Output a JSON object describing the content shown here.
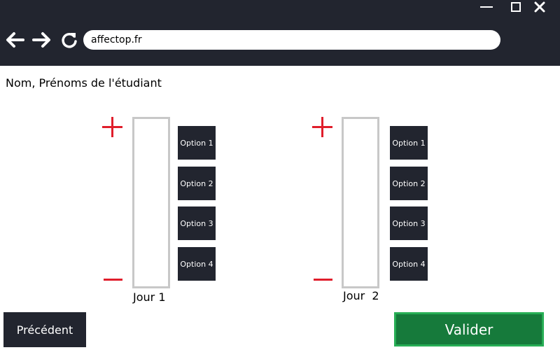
{
  "browser": {
    "url": "affectop.fr",
    "icons": {
      "minimize": "minimize-icon",
      "maximize": "maximize-icon",
      "close": "close-icon",
      "back": "arrow-left-icon",
      "forward": "arrow-right-icon",
      "reload": "reload-icon"
    }
  },
  "form": {
    "student_label": "Nom, Prénoms de l'étudiant",
    "days": [
      {
        "label": "Jour 1",
        "options": [
          "Option 1",
          "Option 2",
          "Option 3",
          "Option 4"
        ]
      },
      {
        "label": "Jour  2",
        "options": [
          "Option 1",
          "Option 2",
          "Option 3",
          "Option 4"
        ]
      }
    ]
  },
  "footer": {
    "previous_label": "Précédent",
    "submit_label": "Valider"
  },
  "colors": {
    "chrome_dark": "#22252f",
    "accent_red": "#e01e2b",
    "submit_green": "#167a3b",
    "submit_border": "#27ae55",
    "slot_border": "#c8c8c8"
  }
}
